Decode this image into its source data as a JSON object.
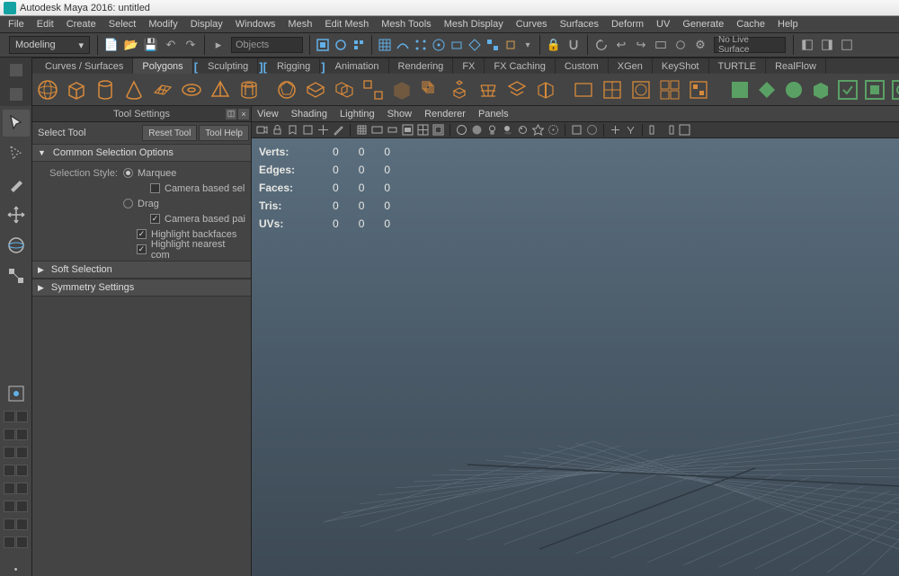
{
  "title": "Autodesk Maya 2016: untitled",
  "menus": [
    "File",
    "Edit",
    "Create",
    "Select",
    "Modify",
    "Display",
    "Windows",
    "Mesh",
    "Edit Mesh",
    "Mesh Tools",
    "Mesh Display",
    "Curves",
    "Surfaces",
    "Deform",
    "UV",
    "Generate",
    "Cache",
    "Help"
  ],
  "mode": "Modeling",
  "search_placeholder": "Objects",
  "no_live": "No Live Surface",
  "shelf_tabs": [
    "Curves / Surfaces",
    "Polygons",
    "Sculpting",
    "Rigging",
    "Animation",
    "Rendering",
    "FX",
    "FX Caching",
    "Custom",
    "XGen",
    "KeyShot",
    "TURTLE",
    "RealFlow"
  ],
  "shelf_active_tab": "Polygons",
  "tool_settings": {
    "panel_title": "Tool Settings",
    "tool_label": "Select Tool",
    "reset_btn": "Reset Tool",
    "help_btn": "Tool Help",
    "sec_common": "Common Selection Options",
    "label_sel_style": "Selection Style:",
    "opt_marquee": "Marquee",
    "opt_camera_sel": "Camera based sel",
    "opt_drag": "Drag",
    "opt_camera_pai": "Camera based pai",
    "opt_hl_backfaces": "Highlight backfaces",
    "opt_hl_nearest": "Highlight nearest com",
    "sec_soft": "Soft Selection",
    "sec_sym": "Symmetry Settings"
  },
  "viewport_menu": [
    "View",
    "Shading",
    "Lighting",
    "Show",
    "Renderer",
    "Panels"
  ],
  "stats": {
    "rows": [
      "Verts:",
      "Edges:",
      "Faces:",
      "Tris:",
      "UVs:"
    ],
    "cols": [
      0,
      0,
      0
    ]
  },
  "colors": {
    "accent_orange": "#d88a3a",
    "accent_blue": "#62b0e8",
    "accent_green": "#5aa065"
  }
}
